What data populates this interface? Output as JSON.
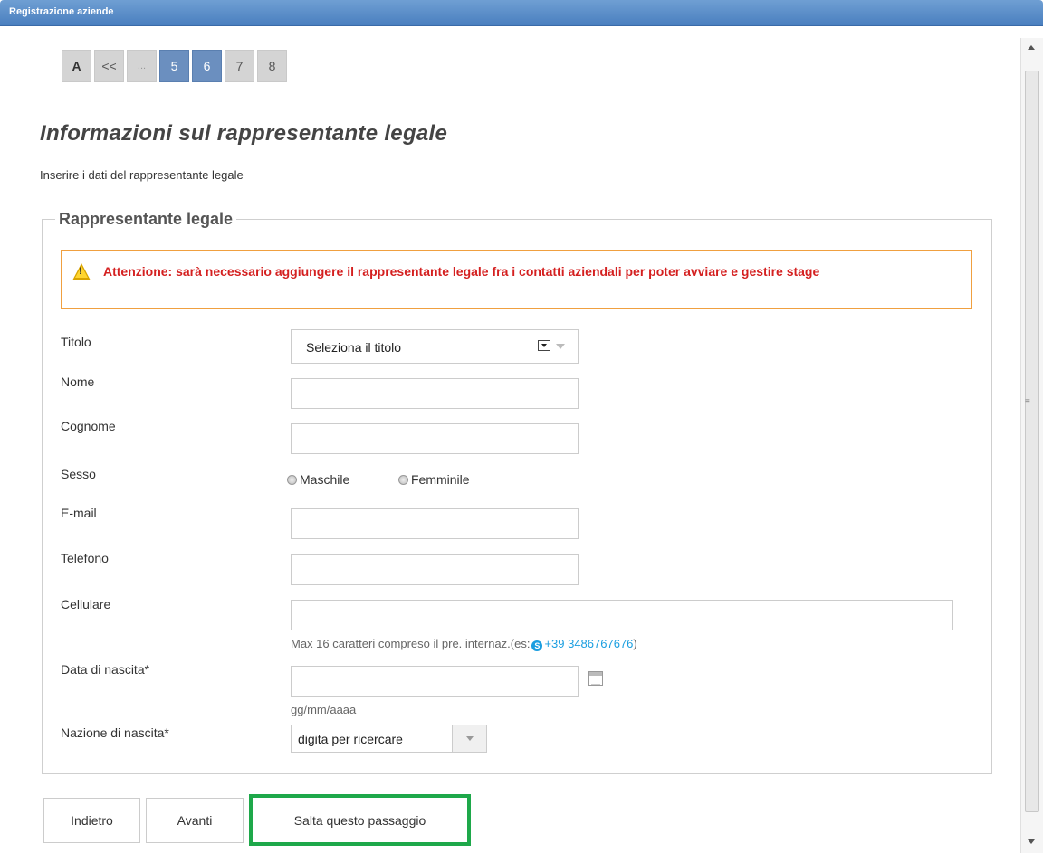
{
  "window": {
    "title": "Registrazione aziende"
  },
  "pager": [
    {
      "label": "A",
      "style": "bold"
    },
    {
      "label": "<<",
      "style": "normal"
    },
    {
      "label": "...",
      "style": "dim"
    },
    {
      "label": "5",
      "style": "active"
    },
    {
      "label": "6",
      "style": "active"
    },
    {
      "label": "7",
      "style": "normal"
    },
    {
      "label": "8",
      "style": "normal"
    }
  ],
  "page": {
    "title": "Informazioni sul rappresentante legale",
    "intro": "Inserire i dati del rappresentante legale"
  },
  "section": {
    "legend": "Rappresentante legale",
    "warning": "Attenzione: sarà necessario aggiungere il rappresentante legale fra i contatti aziendali per poter avviare e gestire stage"
  },
  "form": {
    "titolo": {
      "label": "Titolo",
      "value": "Seleziona il titolo"
    },
    "nome": {
      "label": "Nome",
      "value": ""
    },
    "cognome": {
      "label": "Cognome",
      "value": ""
    },
    "sesso": {
      "label": "Sesso",
      "options": [
        "Maschile",
        "Femminile"
      ]
    },
    "email": {
      "label": "E-mail",
      "value": ""
    },
    "telefono": {
      "label": "Telefono",
      "value": ""
    },
    "cellulare": {
      "label": "Cellulare",
      "value": "",
      "hint": "Max 16 caratteri compreso il pre. internaz.(es:",
      "hint_phone": "+39 3486767676",
      "hint_end": ")"
    },
    "data_nascita": {
      "label": "Data di nascita*",
      "value": "",
      "hint": "gg/mm/aaaa"
    },
    "nazione_nascita": {
      "label": "Nazione di nascita*",
      "value": "digita per ricercare"
    }
  },
  "buttons": {
    "back": "Indietro",
    "next": "Avanti",
    "skip": "Salta questo passaggio"
  },
  "colors": {
    "highlight": "#1ea84a",
    "warning_text": "#d42020",
    "active_page": "#6b8fbf"
  }
}
